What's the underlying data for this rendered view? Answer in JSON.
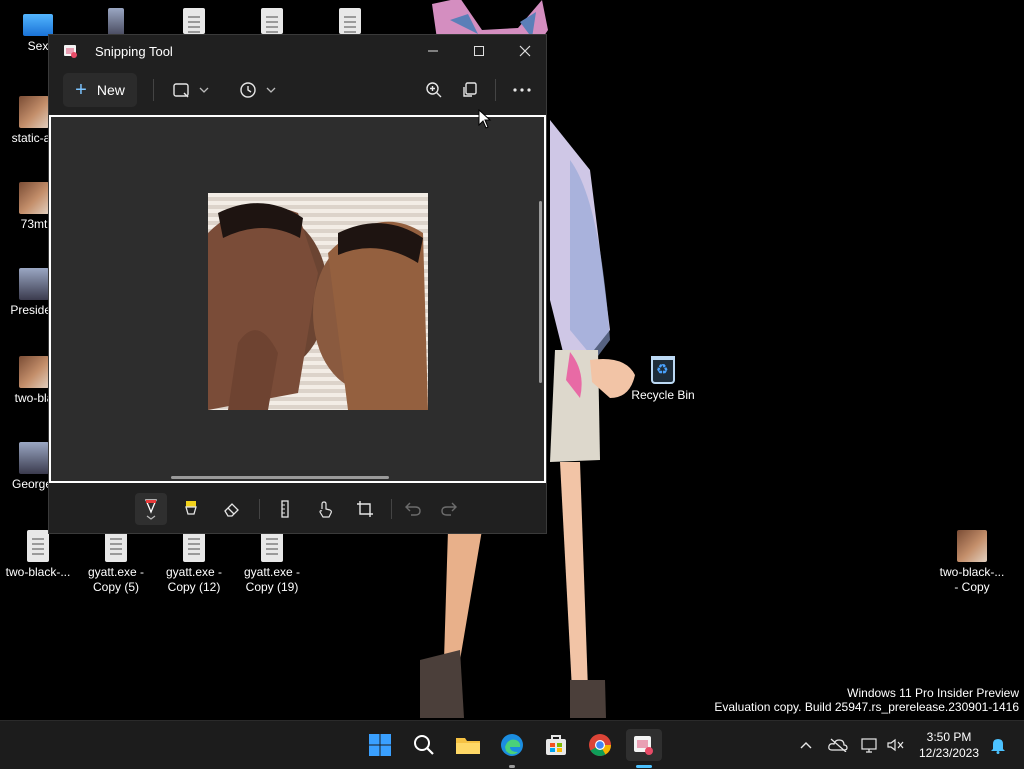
{
  "desktop": {
    "icons": [
      {
        "label": "Sex"
      },
      {
        "label": "static-as"
      },
      {
        "label": "73mt"
      },
      {
        "label": "Presiden"
      },
      {
        "label": "two-bla"
      },
      {
        "label": "George-"
      },
      {
        "label": "two-black-..."
      },
      {
        "label": "gyatt.exe -",
        "label2": "Copy (5)"
      },
      {
        "label": "gyatt.exe -",
        "label2": "Copy (12)"
      },
      {
        "label": "gyatt.exe -",
        "label2": "Copy (19)"
      },
      {
        "label": "two-black-...",
        "label2": "- Copy"
      }
    ],
    "recycle_bin": "Recycle Bin",
    "watermark": {
      "line1": "Windows 11 Pro Insider Preview",
      "line2": "Evaluation copy. Build 25947.rs_prerelease.230901-1416"
    }
  },
  "window": {
    "title": "Snipping Tool",
    "new_label": "New"
  },
  "taskbar": {
    "time": "3:50 PM",
    "date": "12/23/2023"
  },
  "colors": {
    "accent": "#0a84ff",
    "window_bg": "#202020",
    "taskbar_bg": "#1c1c1c"
  }
}
